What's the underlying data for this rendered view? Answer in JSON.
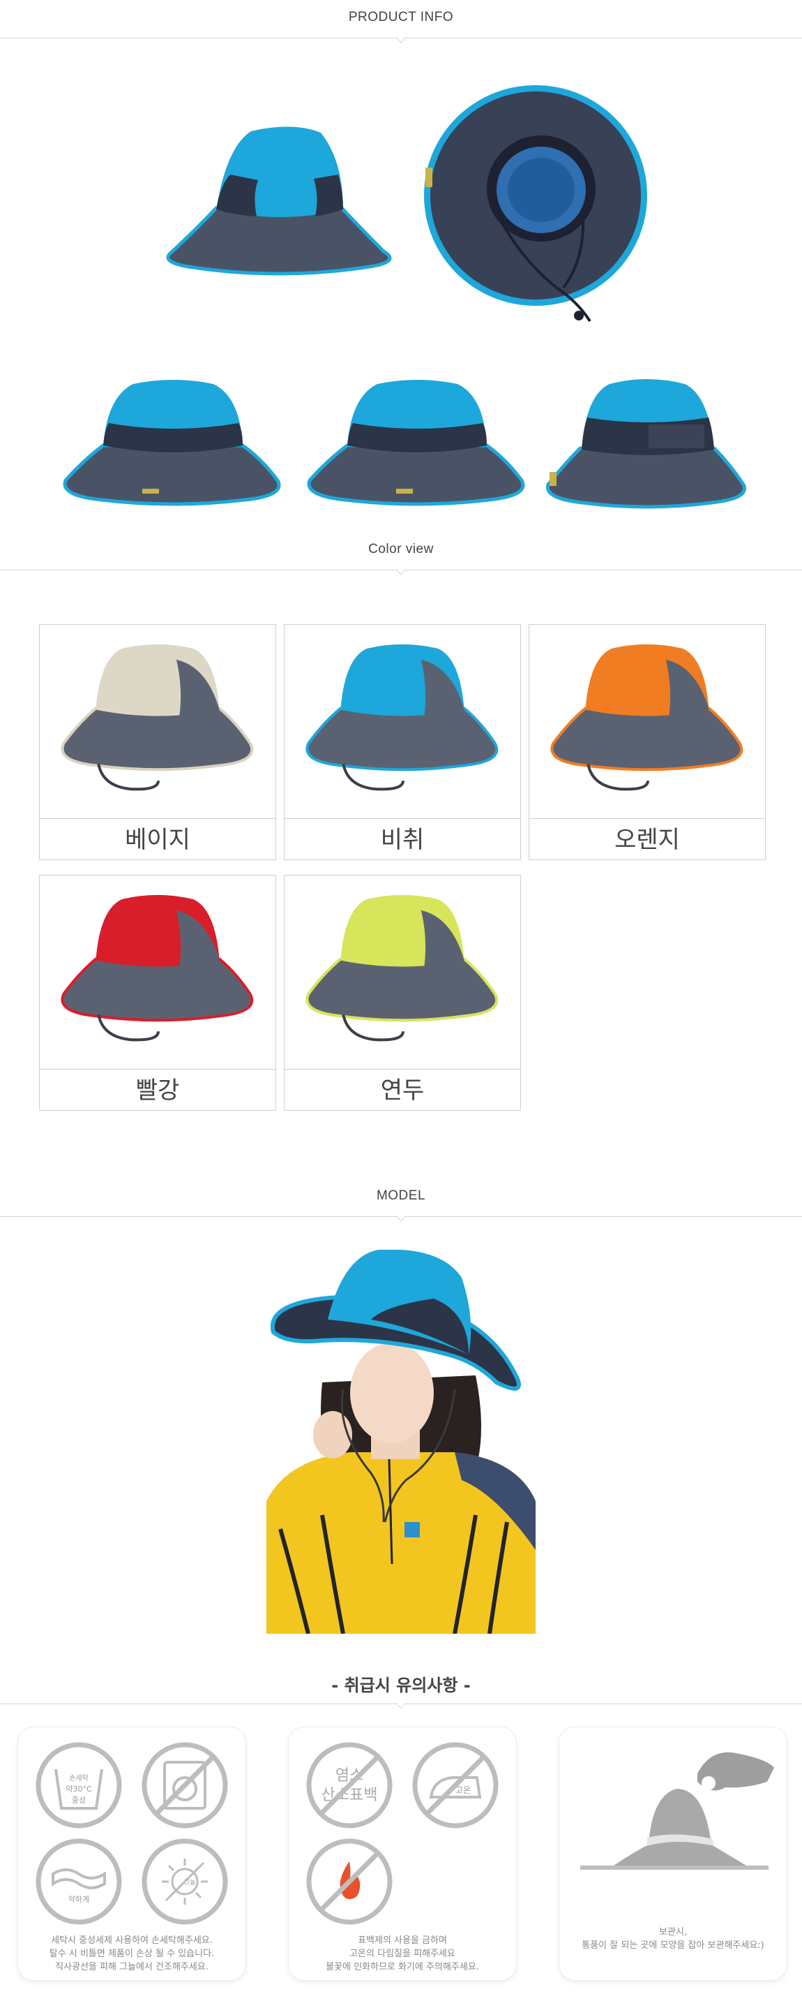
{
  "sections": {
    "product_info": "PRODUCT INFO",
    "color_view": "Color view",
    "model": "MODEL",
    "care_title": "- 취급시 유의사항 -"
  },
  "colors": [
    {
      "label": "베이지",
      "crown": "#ddd7c6",
      "trim": "#d9d2bf"
    },
    {
      "label": "비취",
      "crown": "#1ea7da",
      "trim": "#1ea7da"
    },
    {
      "label": "오렌지",
      "crown": "#f07d22",
      "trim": "#f07d22"
    },
    {
      "label": "빨강",
      "crown": "#d81e2a",
      "trim": "#d81e2a"
    },
    {
      "label": "연두",
      "crown": "#d6e55a",
      "trim": "#d6e55a"
    }
  ],
  "care": {
    "card1": {
      "icon1_lines": [
        "손세탁",
        "약30°C",
        "중성"
      ],
      "icon3_label": "약하게",
      "icon4_label": "그늘",
      "note": [
        "세탁시 중성세제 사용하여 손세탁해주세요.",
        "탈수 시 비틀면 제품이 손상 될 수 있습니다.",
        "직사광선을 피해 그늘에서 건조해주세요."
      ]
    },
    "card2": {
      "icon1_lines": [
        "염소",
        "산소표백"
      ],
      "icon2_label": "고온",
      "note": [
        "표백제의 사용을 금하며",
        "고온의 다림질을 피해주세요",
        "불꽃에 인화하므로 화기에 주의해주세요."
      ]
    },
    "card3": {
      "note": [
        "보관시,",
        "통풍이 잘 되는 곳에 모양을 잡아 보관해주세요:)"
      ]
    }
  },
  "palette": {
    "hat_blue": "#1ea7da",
    "hat_navy": "#2c3447",
    "hat_brim": "#4a5366",
    "shirt_yellow": "#f3c51f",
    "icon_gray": "#bdbdbd"
  }
}
